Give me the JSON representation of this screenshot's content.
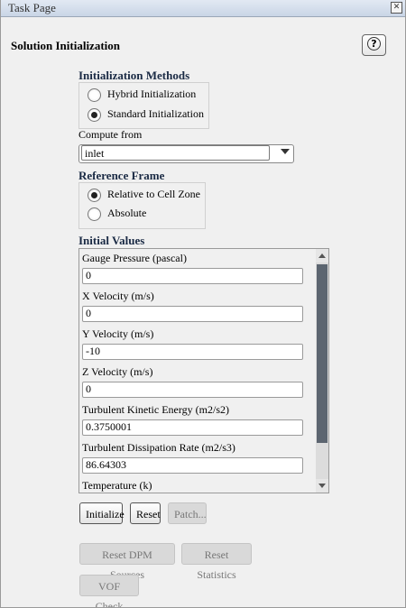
{
  "window": {
    "title": "Task Page",
    "close_glyph": "✕"
  },
  "page": {
    "heading": "Solution Initialization",
    "help_icon": "?"
  },
  "init_methods": {
    "title": "Initialization Methods",
    "options": [
      {
        "label": "Hybrid  Initialization",
        "checked": false
      },
      {
        "label": "Standard Initialization",
        "checked": true
      }
    ]
  },
  "compute_from": {
    "label": "Compute from",
    "value": "inlet"
  },
  "reference_frame": {
    "title": "Reference Frame",
    "options": [
      {
        "label": "Relative to Cell Zone",
        "checked": true
      },
      {
        "label": "Absolute",
        "checked": false
      }
    ]
  },
  "initial_values": {
    "title": "Initial Values",
    "fields": [
      {
        "label": "Gauge Pressure (pascal)",
        "value": "0"
      },
      {
        "label": "X Velocity (m/s)",
        "value": "0"
      },
      {
        "label": "Y Velocity (m/s)",
        "value": "-10"
      },
      {
        "label": "Z Velocity (m/s)",
        "value": "0"
      },
      {
        "label": "Turbulent Kinetic Energy (m2/s2)",
        "value": "0.3750001"
      },
      {
        "label": "Turbulent Dissipation Rate (m2/s3)",
        "value": "86.64303"
      },
      {
        "label": "Temperature (k)",
        "value": ""
      }
    ]
  },
  "buttons": {
    "initialize": "Initialize",
    "reset": "Reset",
    "patch": "Patch...",
    "reset_dpm": "Reset DPM Sources",
    "reset_statistics": "Reset Statistics",
    "vof_check": "VOF Check"
  }
}
